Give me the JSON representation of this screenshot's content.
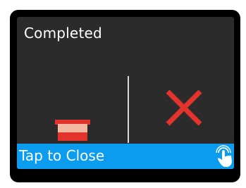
{
  "dialog": {
    "title": "Completed",
    "footer_label": "Tap to Close"
  },
  "icons": {
    "status_icon": "pot-icon",
    "cancel_icon": "close-x-icon",
    "tap_icon": "tap-hand-icon"
  },
  "colors": {
    "panel_background": "#2b2b2b",
    "footer_background": "#0b9cf0",
    "cancel_red": "#e2342d",
    "pot_light": "#f4b9a1",
    "pot_red": "#e2342d"
  }
}
